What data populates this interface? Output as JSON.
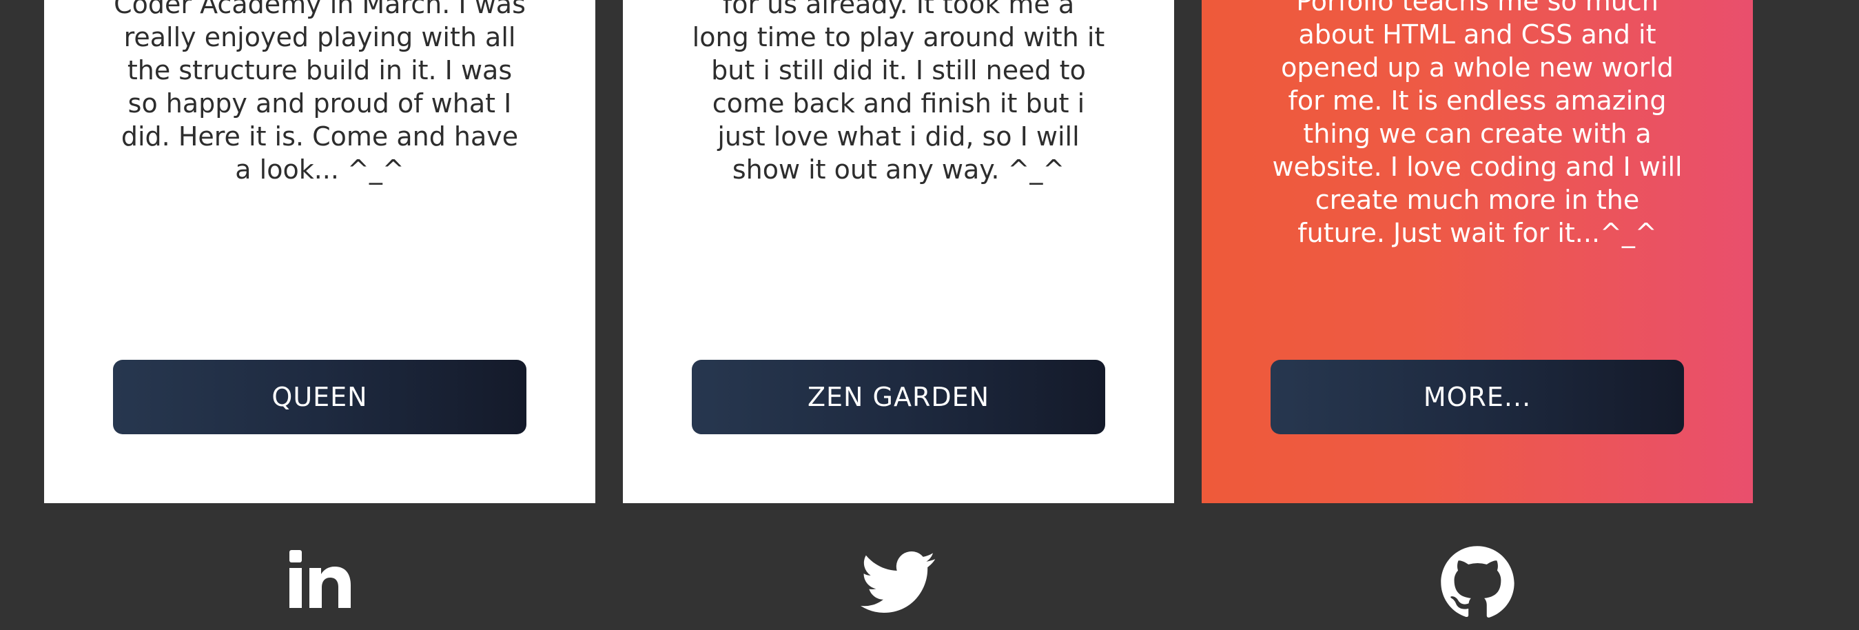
{
  "cards": [
    {
      "text": "Coder Academy in March. I was really enjoyed playing with all the structure build in it. I was so happy and proud of what I did. Here it is. Come and have a look... ^_^",
      "button_label": "QUEEN"
    },
    {
      "text": "for us already. It took me a long time to play around with it but i still did it. I still need to come back and finish it but i just love what i did, so I will show it out any way. ^_^",
      "button_label": "ZEN GARDEN"
    },
    {
      "text": "Porfolio teachs me so much about HTML and CSS and it opened up a whole new world for me. It is endless amazing thing we can create with a website. I love coding and I will create much more in the future. Just wait for it...^_^",
      "button_label": "MORE..."
    }
  ],
  "social": [
    {
      "icon": "linkedin-icon"
    },
    {
      "icon": "twitter-icon"
    },
    {
      "icon": "github-icon"
    }
  ],
  "colors": {
    "background": "#333333",
    "card": "#ffffff",
    "accent_start": "#ee5a3a",
    "accent_end": "#e94f6d",
    "button_start": "#27374f",
    "button_end": "#141a2a"
  }
}
